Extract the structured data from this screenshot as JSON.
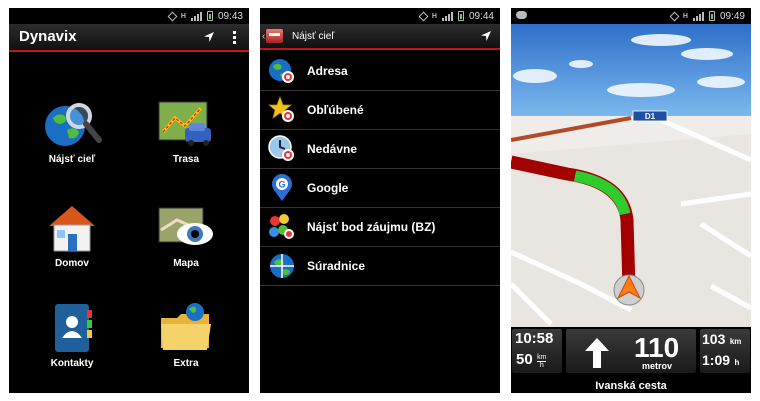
{
  "screens": {
    "home": {
      "status": {
        "time": "09:43"
      },
      "app_title": "Dynavix",
      "tiles": [
        {
          "label": "Nájsť cieľ",
          "icon": "globe-magnifier-icon"
        },
        {
          "label": "Trasa",
          "icon": "route-map-car-icon"
        },
        {
          "label": "Domov",
          "icon": "house-icon"
        },
        {
          "label": "Mapa",
          "icon": "map-eye-icon"
        },
        {
          "label": "Kontakty",
          "icon": "contacts-book-icon"
        },
        {
          "label": "Extra",
          "icon": "folder-globe-icon"
        }
      ]
    },
    "find_destination": {
      "status": {
        "time": "09:44"
      },
      "title": "Nájsť cieľ",
      "items": [
        {
          "label": "Adresa",
          "icon": "globe-target-icon"
        },
        {
          "label": "Obľúbené",
          "icon": "star-target-icon"
        },
        {
          "label": "Nedávne",
          "icon": "clock-target-icon"
        },
        {
          "label": "Google",
          "icon": "google-pin-icon"
        },
        {
          "label": "Nájsť bod záujmu (BZ)",
          "icon": "poi-icons-icon"
        },
        {
          "label": "Súradnice",
          "icon": "globe-crosshair-icon"
        }
      ]
    },
    "navigation": {
      "status": {
        "time": "09:49"
      },
      "road_sign": "D1",
      "hud": {
        "arrival_time": "10:58",
        "speed": "50",
        "speed_unit_top": "km",
        "speed_unit_bottom": "h",
        "next_turn_distance": "110",
        "next_turn_unit": "metrov",
        "remaining_distance": "103",
        "remaining_distance_unit": "km",
        "remaining_time": "1:09",
        "remaining_time_unit": "h",
        "street_name": "Ivanská cesta"
      }
    }
  },
  "colors": {
    "accent_red": "#c41414",
    "route_red": "#a30000",
    "route_green": "#2ecc2e",
    "sky": "#3a7fd0"
  }
}
